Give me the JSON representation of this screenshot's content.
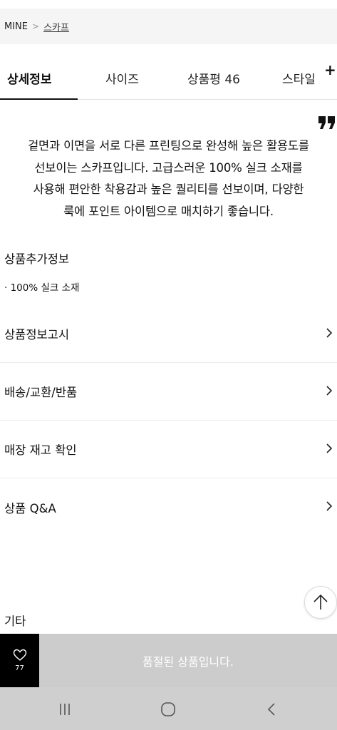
{
  "breadcrumb": {
    "root": "MINE",
    "separator": ">",
    "current": "스카프"
  },
  "tabs": [
    {
      "label": "상세정보"
    },
    {
      "label": "사이즈"
    },
    {
      "label": "상품평 46"
    },
    {
      "label": "스타일"
    }
  ],
  "plus_symbol": "+",
  "description_lines": [
    "겉면과 이면을 서로 다른 프린팅으로 완성해 높은 활용도를",
    "선보이는 스카프입니다. 고급스러운 100% 실크 소재를",
    "사용해 편안한 착용감과 높은 퀄리티를 선보이며, 다양한",
    "룩에 포인트 아이템으로 매치하기 좋습니다."
  ],
  "extra_info": {
    "title": "상품추가정보",
    "item": "· 100% 실크 소재"
  },
  "accordion": [
    {
      "label": "상품정보고시"
    },
    {
      "label": "배송/교환/반품"
    },
    {
      "label": "매장 재고 확인"
    },
    {
      "label": "상품 Q&A"
    }
  ],
  "other_title": "기타",
  "bottom_bar": {
    "like_count": "77",
    "soldout_text": "품절된 상품입니다."
  },
  "colors": {
    "bottom_bar_bg": "#cccccc",
    "like_bg": "#000000"
  },
  "icons": [
    "quote-icon",
    "plus-icon",
    "chevron-right-icon",
    "arrow-up-icon",
    "heart-icon",
    "recent-apps-icon",
    "home-icon",
    "back-icon"
  ]
}
